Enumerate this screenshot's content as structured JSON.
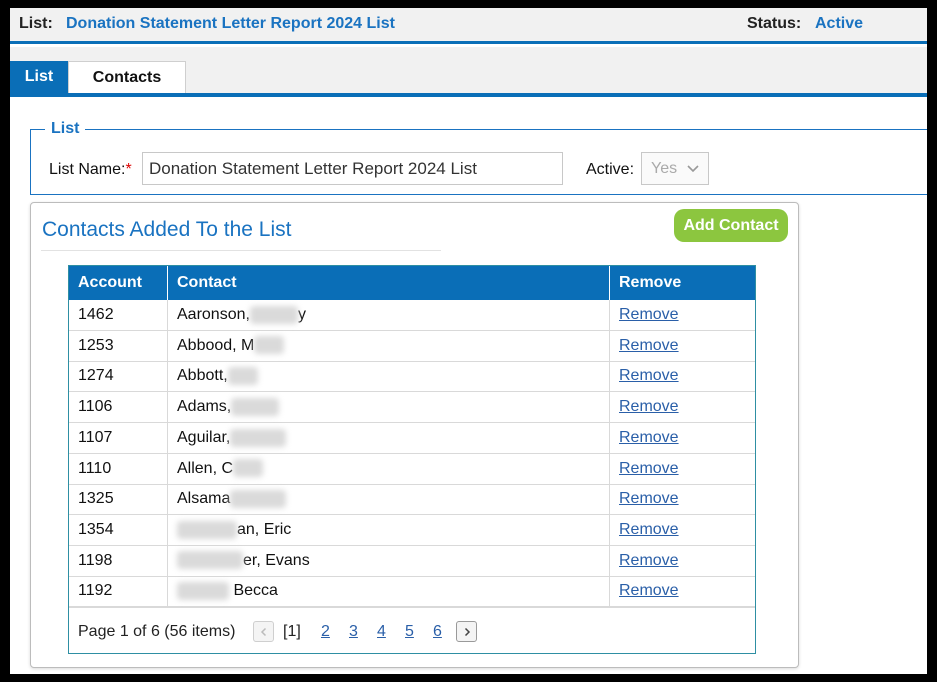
{
  "header": {
    "list_label": "List:",
    "list_value": "Donation Statement Letter Report 2024 List",
    "status_label": "Status:",
    "status_value": "Active"
  },
  "tabs": [
    {
      "label": "List",
      "active": true
    },
    {
      "label": "Contacts",
      "active": false
    }
  ],
  "form": {
    "legend": "List",
    "list_name_label": "List Name:",
    "required_marker": "*",
    "list_name_value": "Donation Statement Letter Report 2024 List",
    "active_label": "Active:",
    "active_value": "Yes"
  },
  "panel": {
    "title": "Contacts Added To the List",
    "add_button": "Add Contact"
  },
  "grid": {
    "columns": [
      "Account",
      "Contact",
      "Remove"
    ],
    "rows": [
      {
        "account": "1462",
        "contact_pre": "Aaronson,",
        "contact_post": "y",
        "remove": "Remove"
      },
      {
        "account": "1253",
        "contact_pre": "Abbood, M",
        "contact_post": "",
        "remove": "Remove"
      },
      {
        "account": "1274",
        "contact_pre": "Abbott,",
        "contact_post": "",
        "remove": "Remove"
      },
      {
        "account": "1106",
        "contact_pre": "Adams,",
        "contact_post": "",
        "remove": "Remove"
      },
      {
        "account": "1107",
        "contact_pre": "Aguilar,",
        "contact_post": "",
        "remove": "Remove"
      },
      {
        "account": "1110",
        "contact_pre": "Allen, C",
        "contact_post": "",
        "remove": "Remove"
      },
      {
        "account": "1325",
        "contact_pre": "Alsama",
        "contact_post": "",
        "remove": "Remove"
      },
      {
        "account": "1354",
        "contact_pre": "",
        "contact_post": "an, Eric",
        "remove": "Remove"
      },
      {
        "account": "1198",
        "contact_pre": "",
        "contact_post": "er, Evans",
        "remove": "Remove"
      },
      {
        "account": "1192",
        "contact_pre": "",
        "contact_post": " Becca",
        "remove": "Remove"
      }
    ],
    "pager": {
      "info": "Page 1 of 6 (56 items)",
      "current": "[1]",
      "pages": [
        "2",
        "3",
        "4",
        "5",
        "6"
      ]
    }
  },
  "colors": {
    "accent_blue": "#0a6eb7",
    "link_blue": "#1a73c1",
    "add_green": "#8cc63f"
  }
}
